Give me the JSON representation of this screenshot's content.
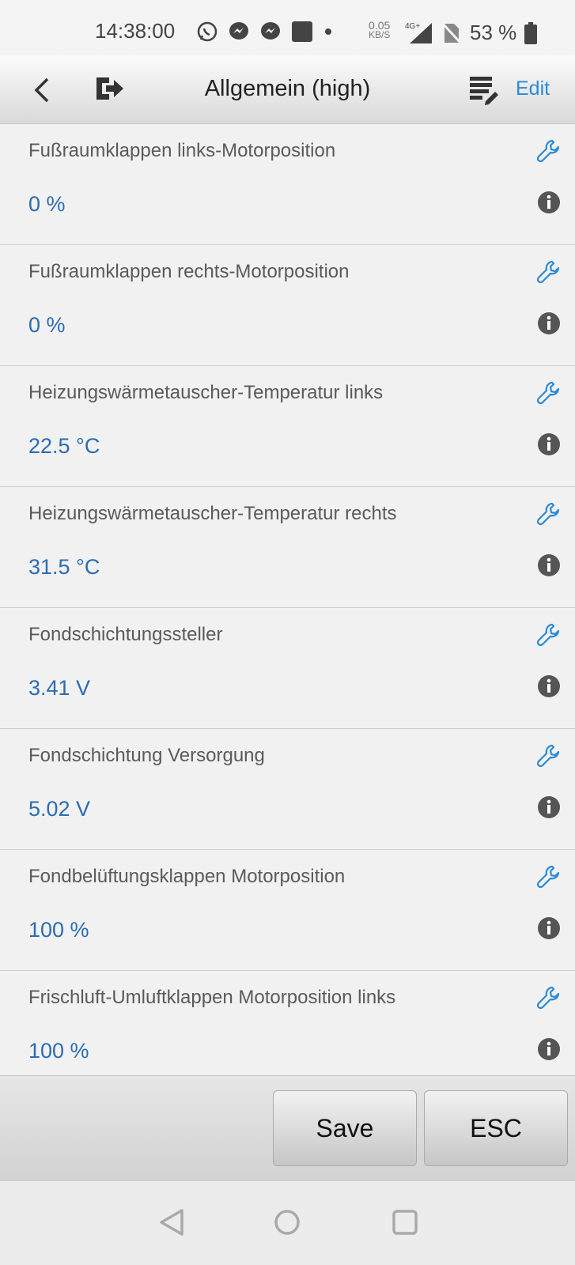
{
  "status": {
    "time": "14:38:00",
    "net_speed": "0.05",
    "net_unit": "KB/S",
    "network": "4G+",
    "battery": "53 %"
  },
  "appbar": {
    "title": "Allgemein (high)",
    "edit_label": "Edit"
  },
  "items": [
    {
      "label": "Fußraumklappen links-Motorposition",
      "value": "0 %"
    },
    {
      "label": "Fußraumklappen rechts-Motorposition",
      "value": "0 %"
    },
    {
      "label": "Heizungswärmetauscher-Temperatur links",
      "value": "22.5 °C"
    },
    {
      "label": "Heizungswärmetauscher-Temperatur rechts",
      "value": "31.5 °C"
    },
    {
      "label": "Fondschichtungssteller",
      "value": "3.41 V"
    },
    {
      "label": "Fondschichtung Versorgung",
      "value": "5.02 V"
    },
    {
      "label": "Fondbelüftungsklappen Motorposition",
      "value": "100 %"
    },
    {
      "label": "Frischluft-Umluftklappen Motorposition links",
      "value": "100 %"
    }
  ],
  "toolbar": {
    "save_label": "Save",
    "esc_label": "ESC"
  },
  "colors": {
    "accent": "#2a8ad6",
    "value": "#2b6cb3"
  }
}
